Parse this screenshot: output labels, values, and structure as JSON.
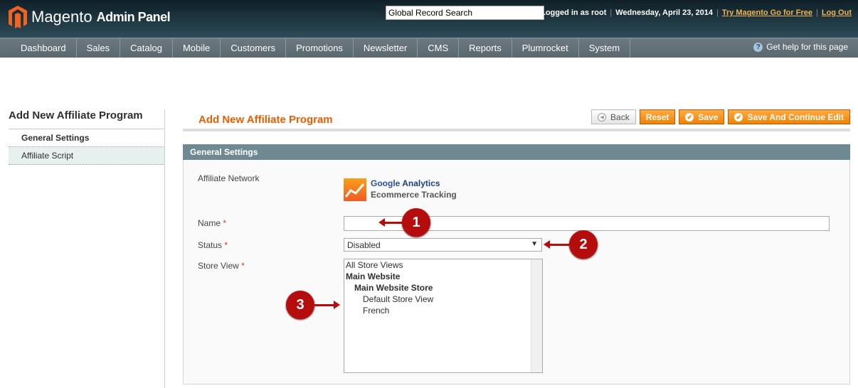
{
  "header": {
    "logo_main": "Magento",
    "logo_sub": "Admin Panel",
    "search_value": "Global Record Search",
    "logged_in": "Logged in as root",
    "date": "Wednesday, April 23, 2014",
    "try_link": "Try Magento Go for Free",
    "logout": "Log Out"
  },
  "nav": {
    "items": [
      "Dashboard",
      "Sales",
      "Catalog",
      "Mobile",
      "Customers",
      "Promotions",
      "Newsletter",
      "CMS",
      "Reports",
      "Plumrocket",
      "System"
    ],
    "help": "Get help for this page"
  },
  "sidebar": {
    "title": "Add New Affiliate Program",
    "tabs": [
      {
        "label": "General Settings",
        "active": true
      },
      {
        "label": "Affiliate Script",
        "active": false
      }
    ]
  },
  "main": {
    "title": "Add New Affiliate Program",
    "buttons": {
      "back": "Back",
      "reset": "Reset",
      "save": "Save",
      "save_continue": "Save And Continue Edit"
    },
    "section": "General Settings",
    "fields": {
      "network_label": "Affiliate Network",
      "network_name_g": "Google",
      "network_name_a": "Analytics",
      "network_sub": "Ecommerce Tracking",
      "name_label": "Name",
      "name_value": "",
      "status_label": "Status",
      "status_value": "Disabled",
      "store_label": "Store View",
      "required": "*",
      "store_options": [
        "All Store Views",
        "Main Website",
        "Main Website Store",
        "Default Store View",
        "French"
      ]
    }
  },
  "callouts": [
    "1",
    "2",
    "3"
  ],
  "colors": {
    "accent": "#eb5e00",
    "button": "#f18200",
    "callout": "#b50d0d",
    "section": "#6f8992"
  }
}
